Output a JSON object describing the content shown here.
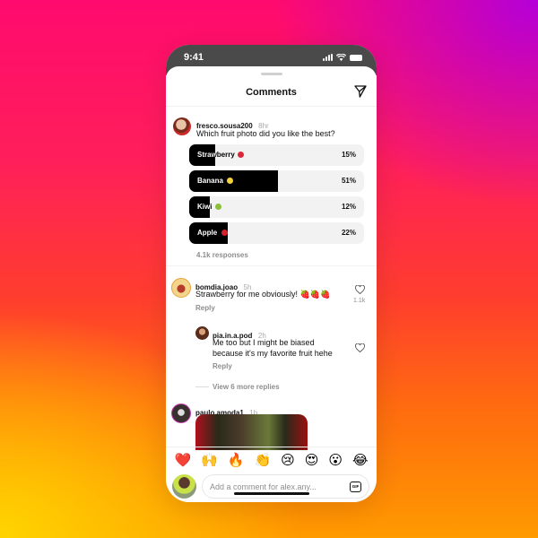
{
  "status_bar": {
    "time": "9:41"
  },
  "header": {
    "title": "Comments",
    "share_icon": "paper-plane-icon"
  },
  "post": {
    "username": "fresco.sousa200",
    "time": "8hr",
    "text": "Which fruit photo did you like the best?",
    "poll": {
      "options": [
        {
          "label": "Strawberry",
          "emoji": "strawberry",
          "emoji_color": "#d8283a",
          "percent": 15,
          "percent_label": "15%"
        },
        {
          "label": "Banana",
          "emoji": "banana",
          "emoji_color": "#f5d23a",
          "percent": 51,
          "percent_label": "51%"
        },
        {
          "label": "Kiwi",
          "emoji": "kiwi",
          "emoji_color": "#8bbf3a",
          "percent": 12,
          "percent_label": "12%"
        },
        {
          "label": "Apple",
          "emoji": "apple",
          "emoji_color": "#d81f2b",
          "percent": 22,
          "percent_label": "22%"
        }
      ],
      "responses": "4.1k responses"
    }
  },
  "comments": [
    {
      "username": "bomdia.joao",
      "time": "5h",
      "text": "Strawberry for me obviously! 🍓🍓🍓",
      "likes": "1.1k",
      "reply_label": "Reply",
      "replies": [
        {
          "username": "pia.in.a.pod",
          "time": "2h",
          "text": "Me too but I might be biased because it's my favorite fruit hehe",
          "reply_label": "Reply"
        }
      ],
      "view_more": "View 6 more replies"
    },
    {
      "username": "paulo.amoda1",
      "time": "1h"
    }
  ],
  "emoji_bar": [
    "❤️",
    "🙌",
    "🔥",
    "👏",
    "😢",
    "😍",
    "😮",
    "😂"
  ],
  "composer": {
    "placeholder": "Add a comment for alex.any...",
    "gif_label": "GIF"
  },
  "colors": {
    "poll_fill": "#000000",
    "poll_track": "#f2f2f2",
    "status_bar": "#4a4a4a"
  }
}
